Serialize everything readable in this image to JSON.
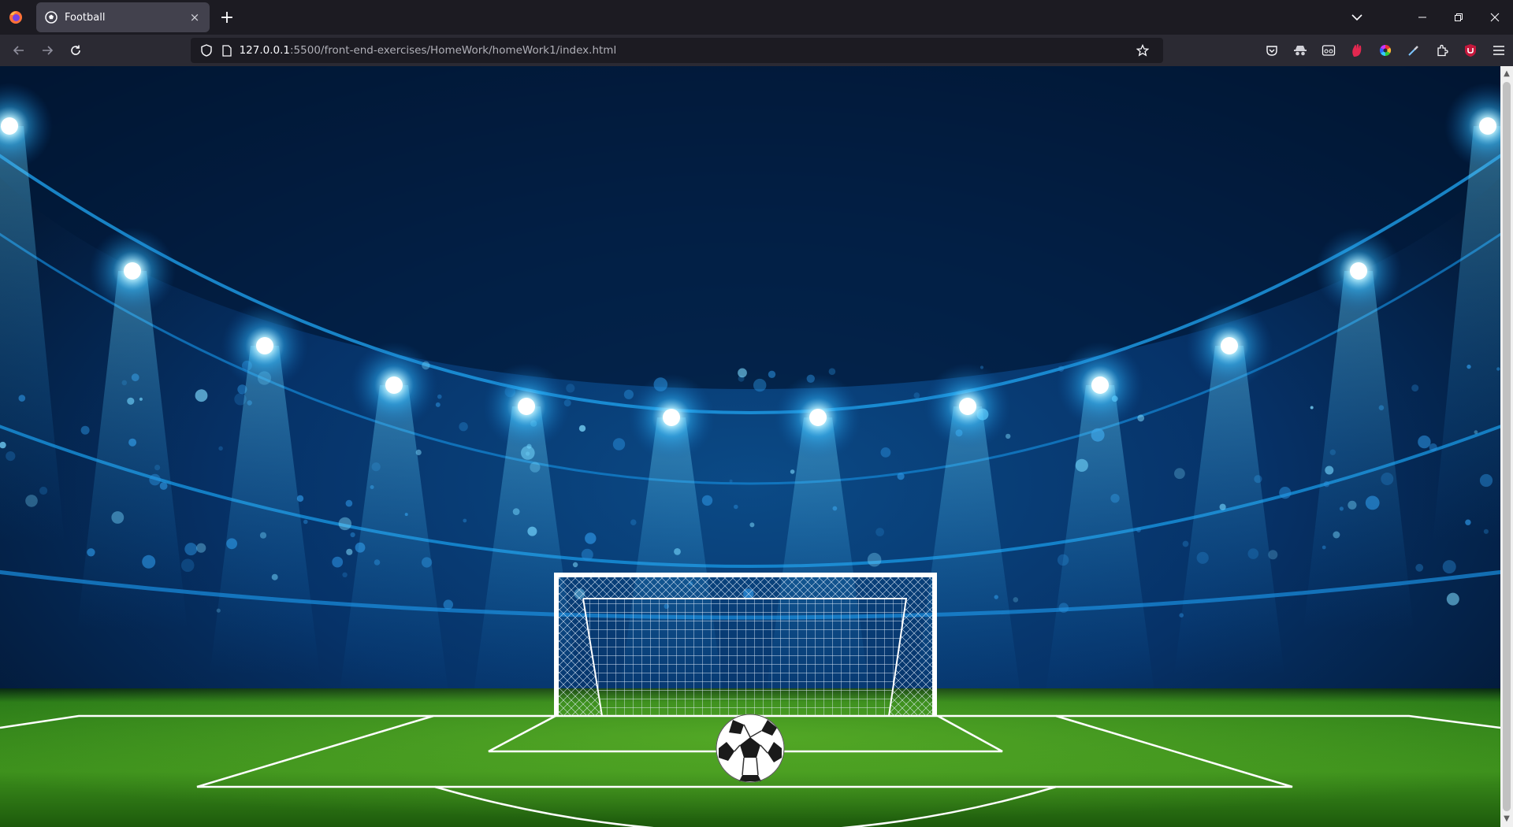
{
  "browser": {
    "tab": {
      "title": "Football",
      "close": "×"
    },
    "new_tab": "+",
    "url": {
      "host": "127.0.0.1",
      "path": ":5500/front-end-exercises/HomeWork/homeWork1/index.html"
    }
  },
  "colors": {
    "sky_top": "#021a3a",
    "light_glow": "#2fb8ff",
    "grass": "#3c8f1c",
    "grass_dark": "#1d5a0c",
    "lines": "#ffffff"
  },
  "icons": {
    "browser_logo": "firefox-logo",
    "tab_favicon": "soccer-ball-icon",
    "address_bar": [
      "shield-icon",
      "page-icon"
    ],
    "bookmark": "star-icon",
    "toolbar": [
      "pocket-icon",
      "incognito-icon",
      "reader-icon",
      "extension-red-icon",
      "color-wheel-icon",
      "eyedropper-icon",
      "extensions-icon",
      "ublock-icon",
      "hamburger-menu-icon"
    ],
    "window": [
      "minimize-icon",
      "restore-icon",
      "close-icon"
    ]
  }
}
